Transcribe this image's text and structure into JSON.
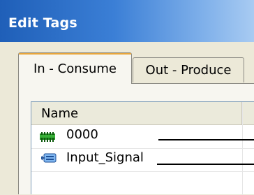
{
  "window": {
    "title": "Edit Tags"
  },
  "tabs": [
    {
      "label": "In - Consume",
      "active": true
    },
    {
      "label": "Out - Produce",
      "active": false
    }
  ],
  "grid": {
    "columns": [
      {
        "label": "Name"
      }
    ],
    "rows": [
      {
        "name": "0000",
        "icon": "module-icon",
        "icon_color": "#1f8a1f"
      },
      {
        "name": "Input_Signal",
        "icon": "network-signal-icon",
        "icon_color": "#2a6fc9"
      }
    ]
  },
  "colors": {
    "title_bar": "#3b7fd6",
    "tab_accent": "#e7a53b",
    "window_face": "#ece9d8"
  }
}
